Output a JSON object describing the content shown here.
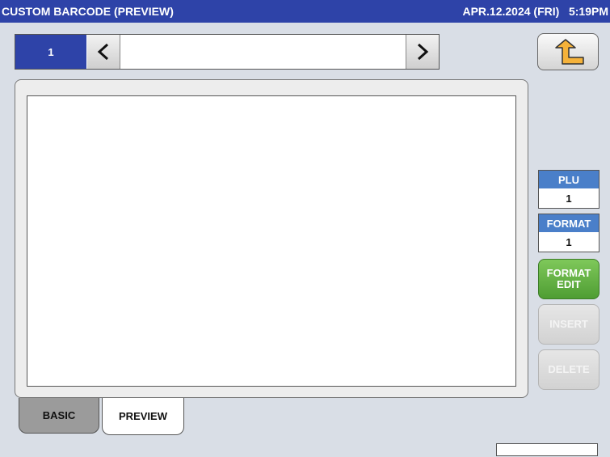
{
  "header": {
    "title": "CUSTOM BARCODE (PREVIEW)",
    "clock": "APR.12.2024 (FRI)   5:19PM"
  },
  "nav": {
    "index": "1",
    "field_value": ""
  },
  "tabs": [
    {
      "label": "BASIC"
    },
    {
      "label": "PREVIEW"
    }
  ],
  "side": {
    "plu_label": "PLU",
    "plu_value": "1",
    "format_label": "FORMAT",
    "format_value": "1",
    "format_edit_label": "FORMAT\nEDIT",
    "insert_label": "INSERT",
    "delete_label": "DELETE"
  },
  "status": {
    "text": ""
  },
  "colors": {
    "title_bar": "#2e43a8",
    "accent_blue": "#4a7fc9",
    "edit_green": "#5aae3a"
  }
}
